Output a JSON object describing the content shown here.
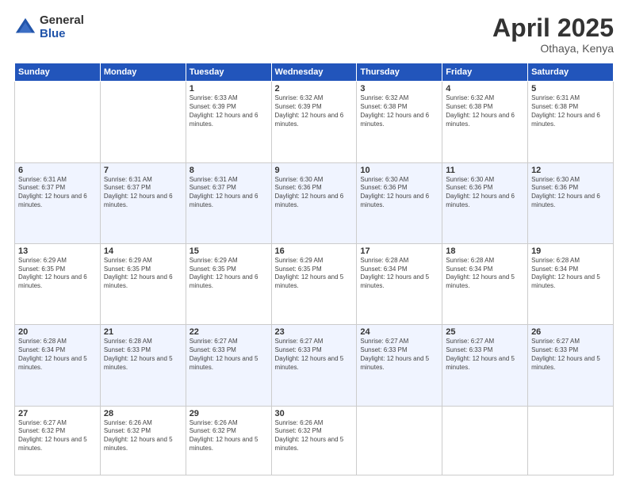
{
  "logo": {
    "general": "General",
    "blue": "Blue"
  },
  "title": {
    "month": "April 2025",
    "location": "Othaya, Kenya"
  },
  "headers": [
    "Sunday",
    "Monday",
    "Tuesday",
    "Wednesday",
    "Thursday",
    "Friday",
    "Saturday"
  ],
  "weeks": [
    [
      {
        "num": "",
        "sunrise": "",
        "sunset": "",
        "daylight": ""
      },
      {
        "num": "",
        "sunrise": "",
        "sunset": "",
        "daylight": ""
      },
      {
        "num": "1",
        "sunrise": "Sunrise: 6:33 AM",
        "sunset": "Sunset: 6:39 PM",
        "daylight": "Daylight: 12 hours and 6 minutes."
      },
      {
        "num": "2",
        "sunrise": "Sunrise: 6:32 AM",
        "sunset": "Sunset: 6:39 PM",
        "daylight": "Daylight: 12 hours and 6 minutes."
      },
      {
        "num": "3",
        "sunrise": "Sunrise: 6:32 AM",
        "sunset": "Sunset: 6:38 PM",
        "daylight": "Daylight: 12 hours and 6 minutes."
      },
      {
        "num": "4",
        "sunrise": "Sunrise: 6:32 AM",
        "sunset": "Sunset: 6:38 PM",
        "daylight": "Daylight: 12 hours and 6 minutes."
      },
      {
        "num": "5",
        "sunrise": "Sunrise: 6:31 AM",
        "sunset": "Sunset: 6:38 PM",
        "daylight": "Daylight: 12 hours and 6 minutes."
      }
    ],
    [
      {
        "num": "6",
        "sunrise": "Sunrise: 6:31 AM",
        "sunset": "Sunset: 6:37 PM",
        "daylight": "Daylight: 12 hours and 6 minutes."
      },
      {
        "num": "7",
        "sunrise": "Sunrise: 6:31 AM",
        "sunset": "Sunset: 6:37 PM",
        "daylight": "Daylight: 12 hours and 6 minutes."
      },
      {
        "num": "8",
        "sunrise": "Sunrise: 6:31 AM",
        "sunset": "Sunset: 6:37 PM",
        "daylight": "Daylight: 12 hours and 6 minutes."
      },
      {
        "num": "9",
        "sunrise": "Sunrise: 6:30 AM",
        "sunset": "Sunset: 6:36 PM",
        "daylight": "Daylight: 12 hours and 6 minutes."
      },
      {
        "num": "10",
        "sunrise": "Sunrise: 6:30 AM",
        "sunset": "Sunset: 6:36 PM",
        "daylight": "Daylight: 12 hours and 6 minutes."
      },
      {
        "num": "11",
        "sunrise": "Sunrise: 6:30 AM",
        "sunset": "Sunset: 6:36 PM",
        "daylight": "Daylight: 12 hours and 6 minutes."
      },
      {
        "num": "12",
        "sunrise": "Sunrise: 6:30 AM",
        "sunset": "Sunset: 6:36 PM",
        "daylight": "Daylight: 12 hours and 6 minutes."
      }
    ],
    [
      {
        "num": "13",
        "sunrise": "Sunrise: 6:29 AM",
        "sunset": "Sunset: 6:35 PM",
        "daylight": "Daylight: 12 hours and 6 minutes."
      },
      {
        "num": "14",
        "sunrise": "Sunrise: 6:29 AM",
        "sunset": "Sunset: 6:35 PM",
        "daylight": "Daylight: 12 hours and 6 minutes."
      },
      {
        "num": "15",
        "sunrise": "Sunrise: 6:29 AM",
        "sunset": "Sunset: 6:35 PM",
        "daylight": "Daylight: 12 hours and 6 minutes."
      },
      {
        "num": "16",
        "sunrise": "Sunrise: 6:29 AM",
        "sunset": "Sunset: 6:35 PM",
        "daylight": "Daylight: 12 hours and 5 minutes."
      },
      {
        "num": "17",
        "sunrise": "Sunrise: 6:28 AM",
        "sunset": "Sunset: 6:34 PM",
        "daylight": "Daylight: 12 hours and 5 minutes."
      },
      {
        "num": "18",
        "sunrise": "Sunrise: 6:28 AM",
        "sunset": "Sunset: 6:34 PM",
        "daylight": "Daylight: 12 hours and 5 minutes."
      },
      {
        "num": "19",
        "sunrise": "Sunrise: 6:28 AM",
        "sunset": "Sunset: 6:34 PM",
        "daylight": "Daylight: 12 hours and 5 minutes."
      }
    ],
    [
      {
        "num": "20",
        "sunrise": "Sunrise: 6:28 AM",
        "sunset": "Sunset: 6:34 PM",
        "daylight": "Daylight: 12 hours and 5 minutes."
      },
      {
        "num": "21",
        "sunrise": "Sunrise: 6:28 AM",
        "sunset": "Sunset: 6:33 PM",
        "daylight": "Daylight: 12 hours and 5 minutes."
      },
      {
        "num": "22",
        "sunrise": "Sunrise: 6:27 AM",
        "sunset": "Sunset: 6:33 PM",
        "daylight": "Daylight: 12 hours and 5 minutes."
      },
      {
        "num": "23",
        "sunrise": "Sunrise: 6:27 AM",
        "sunset": "Sunset: 6:33 PM",
        "daylight": "Daylight: 12 hours and 5 minutes."
      },
      {
        "num": "24",
        "sunrise": "Sunrise: 6:27 AM",
        "sunset": "Sunset: 6:33 PM",
        "daylight": "Daylight: 12 hours and 5 minutes."
      },
      {
        "num": "25",
        "sunrise": "Sunrise: 6:27 AM",
        "sunset": "Sunset: 6:33 PM",
        "daylight": "Daylight: 12 hours and 5 minutes."
      },
      {
        "num": "26",
        "sunrise": "Sunrise: 6:27 AM",
        "sunset": "Sunset: 6:33 PM",
        "daylight": "Daylight: 12 hours and 5 minutes."
      }
    ],
    [
      {
        "num": "27",
        "sunrise": "Sunrise: 6:27 AM",
        "sunset": "Sunset: 6:32 PM",
        "daylight": "Daylight: 12 hours and 5 minutes."
      },
      {
        "num": "28",
        "sunrise": "Sunrise: 6:26 AM",
        "sunset": "Sunset: 6:32 PM",
        "daylight": "Daylight: 12 hours and 5 minutes."
      },
      {
        "num": "29",
        "sunrise": "Sunrise: 6:26 AM",
        "sunset": "Sunset: 6:32 PM",
        "daylight": "Daylight: 12 hours and 5 minutes."
      },
      {
        "num": "30",
        "sunrise": "Sunrise: 6:26 AM",
        "sunset": "Sunset: 6:32 PM",
        "daylight": "Daylight: 12 hours and 5 minutes."
      },
      {
        "num": "",
        "sunrise": "",
        "sunset": "",
        "daylight": ""
      },
      {
        "num": "",
        "sunrise": "",
        "sunset": "",
        "daylight": ""
      },
      {
        "num": "",
        "sunrise": "",
        "sunset": "",
        "daylight": ""
      }
    ]
  ]
}
